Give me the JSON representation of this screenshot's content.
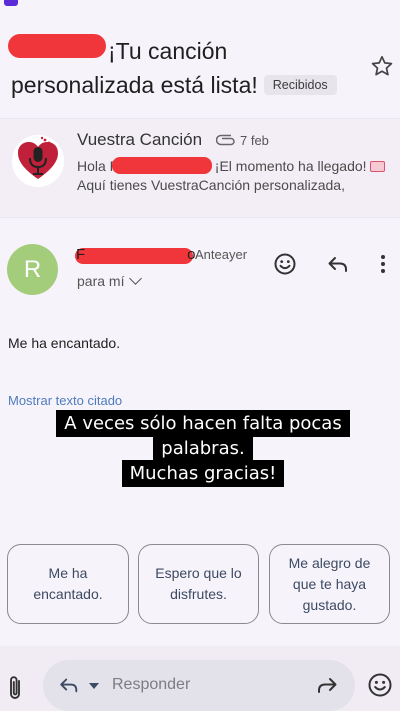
{
  "subject": {
    "text": "¡Tu canción personalizada está lista!",
    "label": "Recibidos"
  },
  "thread_item": {
    "sender": "Vuestra Canción",
    "date": "7 feb",
    "snippet_greeting": "Hola R",
    "snippet_line1_rest": "¡El momento ha llegado!",
    "snippet_line2": "Aquí tienes VuestraCanción personalizada,"
  },
  "message": {
    "avatar_letter": "R",
    "from_initial": "F",
    "from_tail": "o",
    "when": "Anteayer",
    "to": "para mí",
    "body": "Me ha encantado.",
    "show_quoted": "Mostrar texto citado"
  },
  "overlay": {
    "line1": "A veces sólo hacen falta pocas palabras.",
    "line2": "Muchas gracias!"
  },
  "smart_replies": [
    "Me ha encantado.",
    "Espero que lo disfrutes.",
    "Me alegro de que te haya gustado."
  ],
  "compose": {
    "placeholder": "Responder"
  },
  "colors": {
    "redaction": "#f0363b",
    "avatar": "#a3cd7b",
    "link": "#4d7cc0"
  }
}
